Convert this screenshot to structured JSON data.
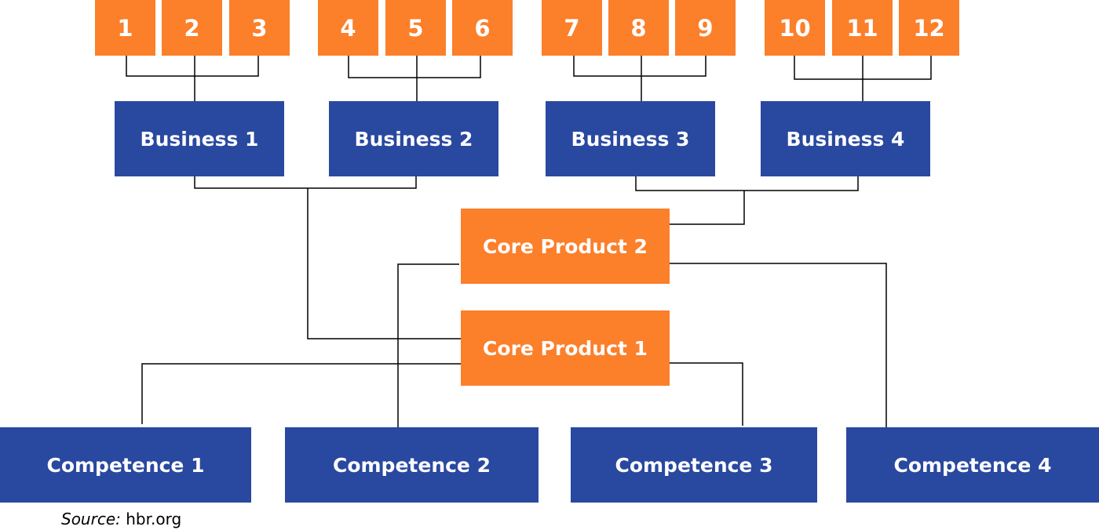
{
  "colors": {
    "orange": "#fc7f2a",
    "blue": "#2948a0",
    "line": "#000000"
  },
  "products": [
    "1",
    "2",
    "3",
    "4",
    "5",
    "6",
    "7",
    "8",
    "9",
    "10",
    "11",
    "12"
  ],
  "businesses": [
    "Business 1",
    "Business 2",
    "Business 3",
    "Business 4"
  ],
  "core_products": [
    "Core Product 1",
    "Core Product 2"
  ],
  "competences": [
    "Competence 1",
    "Competence 2",
    "Competence 3",
    "Competence 4"
  ],
  "source": {
    "label": "Source:",
    "value": "hbr.org"
  }
}
